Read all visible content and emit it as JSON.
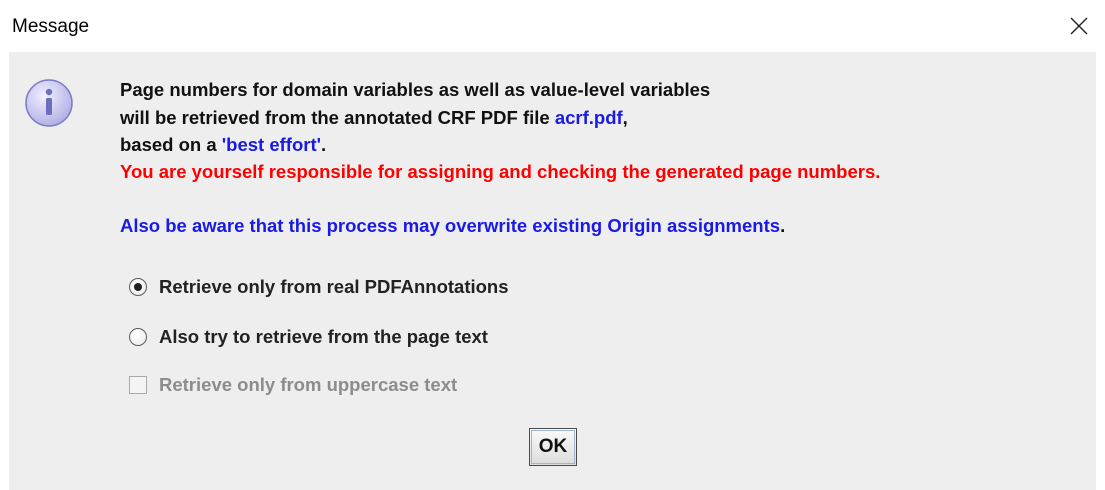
{
  "window": {
    "title": "Message",
    "close_icon": "close-icon"
  },
  "message": {
    "icon": "info-icon",
    "line1": "Page numbers for domain variables as well as value-level variables",
    "line2_prefix": "will be retrieved from the annotated CRF PDF file ",
    "line2_file": "acrf.pdf",
    "line2_suffix": ",",
    "line3_prefix": "based on a ",
    "line3_highlight": "'best effort'",
    "line3_suffix": ".",
    "warning": "You are yourself responsible for assigning and checking the generated page numbers.",
    "aware_prefix": "Also be aware that this process may overwrite existing Origin assignments",
    "aware_suffix": "."
  },
  "options": {
    "radio1": {
      "label": "Retrieve only from real PDFAnnotations",
      "selected": true
    },
    "radio2": {
      "label": "Also try to retrieve from the page text",
      "selected": false
    },
    "checkbox": {
      "label": "Retrieve only from uppercase text",
      "checked": false,
      "enabled": false
    }
  },
  "buttons": {
    "ok_label": "OK"
  },
  "colors": {
    "dialog_bg": "#eeeeee",
    "text": "#111111",
    "link_blue": "#1a1ae6",
    "warning_red": "#ff0000",
    "disabled_text": "#8c8c8c",
    "info_icon_fill": "#c9c8f0"
  }
}
